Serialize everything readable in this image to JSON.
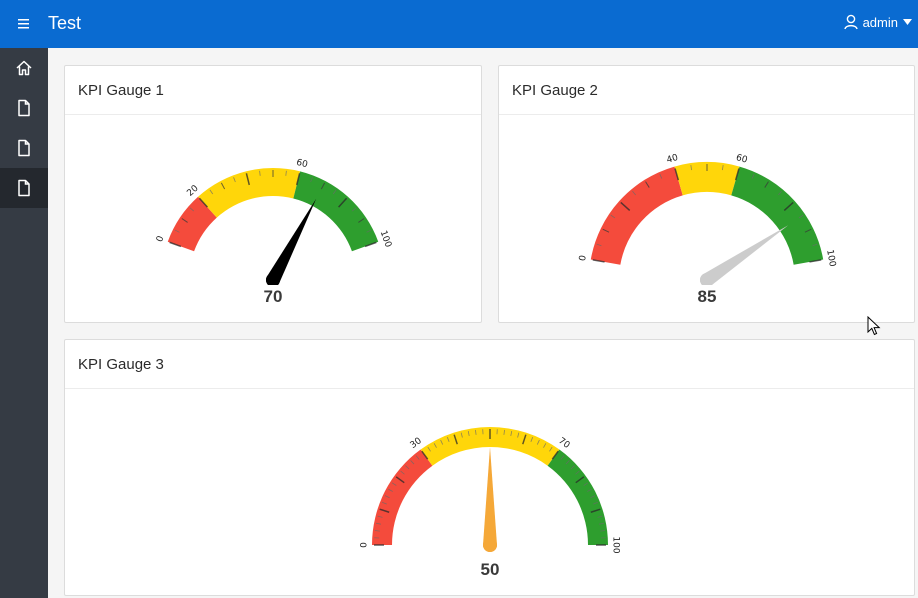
{
  "app": {
    "title": "Test",
    "user": "admin"
  },
  "nav": [
    {
      "icon": "home-icon"
    },
    {
      "icon": "page-icon"
    },
    {
      "icon": "page-icon"
    },
    {
      "icon": "page-icon",
      "active": true
    }
  ],
  "regions": [
    {
      "title": "KPI Gauge 1",
      "value": "70"
    },
    {
      "title": "KPI Gauge 2",
      "value": "85"
    },
    {
      "title": "KPI Gauge 3",
      "value": "50"
    }
  ],
  "gauges": [
    {
      "min": 0,
      "max": 100,
      "value": 70,
      "labels": [
        "0",
        "20",
        "60",
        "100"
      ],
      "bands": [
        {
          "from": 0,
          "to": 20,
          "color": "#f44b3c"
        },
        {
          "from": 20,
          "to": 60,
          "color": "#ffd60a"
        },
        {
          "from": 60,
          "to": 100,
          "color": "#2e9e2e"
        }
      ],
      "needle_color": "#000000"
    },
    {
      "min": 0,
      "max": 100,
      "value": 85,
      "labels": [
        "0",
        "40",
        "60",
        "100"
      ],
      "bands": [
        {
          "from": 0,
          "to": 40,
          "color": "#f44b3c"
        },
        {
          "from": 40,
          "to": 60,
          "color": "#ffd60a"
        },
        {
          "from": 60,
          "to": 100,
          "color": "#2e9e2e"
        }
      ],
      "needle_color": "#cccccc"
    },
    {
      "min": 0,
      "max": 100,
      "value": 50,
      "labels": [
        "0",
        "30",
        "70",
        "100"
      ],
      "bands": [
        {
          "from": 0,
          "to": 30,
          "color": "#f44b3c"
        },
        {
          "from": 30,
          "to": 70,
          "color": "#ffd60a"
        },
        {
          "from": 70,
          "to": 100,
          "color": "#2e9e2e"
        }
      ],
      "needle_color": "#f5a838"
    }
  ],
  "colors": {
    "header": "#0a6bd1",
    "sidebar": "#353b44",
    "sidebar_active": "#24282e"
  }
}
